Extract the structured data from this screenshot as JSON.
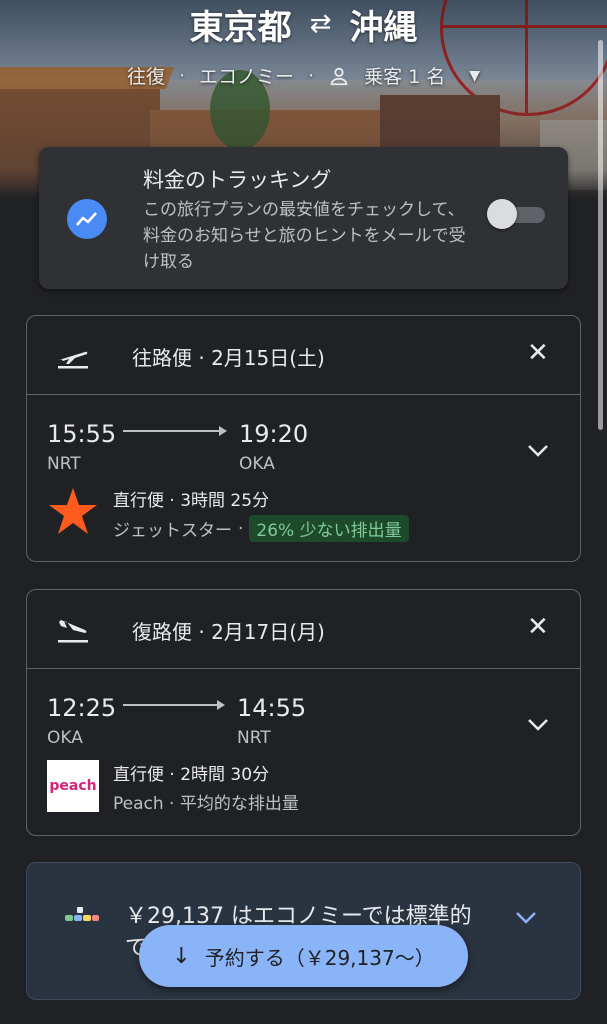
{
  "header": {
    "origin": "東京都",
    "destination": "沖縄",
    "trip_type": "往復",
    "cabin": "エコノミー",
    "passengers": "乗客 1 名"
  },
  "tracking": {
    "title": "料金のトラッキング",
    "description": "この旅行プランの最安値をチェックして、料金のお知らせと旅のヒントをメールで受け取る",
    "enabled": false
  },
  "outbound": {
    "title": "往路便 · 2月15日(土)",
    "depart_time": "15:55",
    "depart_code": "NRT",
    "arrive_time": "19:20",
    "arrive_code": "OKA",
    "details": "直行便 · 3時間 25分",
    "airline": "ジェットスター",
    "separator": "·",
    "emissions": "26% 少ない排出量",
    "logo_icon": "jetstar-star-icon",
    "logo_color": "#ff5b1f"
  },
  "return": {
    "title": "復路便 · 2月17日(月)",
    "depart_time": "12:25",
    "depart_code": "OKA",
    "arrive_time": "14:55",
    "arrive_code": "NRT",
    "details": "直行便 · 2時間 30分",
    "airline_line": "Peach · 平均的な排出量",
    "logo_text": "peach",
    "logo_color": "#d6247b"
  },
  "price_note": {
    "text": "￥29,137 はエコノミーでは標準的です"
  },
  "book_button": {
    "label": "予約する（￥29,137〜）"
  },
  "colors": {
    "accent": "#8ab4f8",
    "eco_green": "#81c995",
    "card_bg": "#303134"
  }
}
